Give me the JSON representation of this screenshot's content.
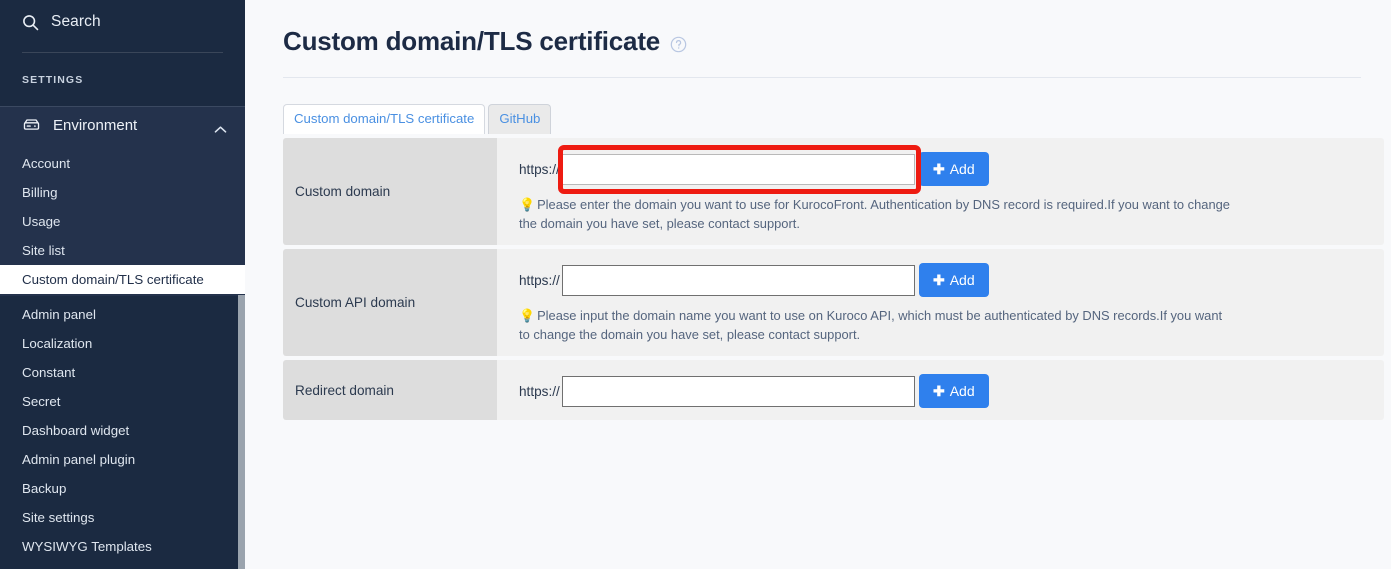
{
  "sidebar": {
    "search": {
      "label": "Search",
      "icon": "search-icon"
    },
    "section_label": "SETTINGS",
    "group": {
      "label": "Environment",
      "icon": "server-icon",
      "chevron": "chevron-up-icon",
      "expanded": true
    },
    "items": [
      {
        "label": "Account",
        "active": false
      },
      {
        "label": "Billing",
        "active": false
      },
      {
        "label": "Usage",
        "active": false
      },
      {
        "label": "Site list",
        "active": false
      },
      {
        "label": "Custom domain/TLS certificate",
        "active": true
      },
      {
        "label": "Admin panel",
        "active": false
      },
      {
        "label": "Localization",
        "active": false
      },
      {
        "label": "Constant",
        "active": false
      },
      {
        "label": "Secret",
        "active": false
      },
      {
        "label": "Dashboard widget",
        "active": false
      },
      {
        "label": "Admin panel plugin",
        "active": false
      },
      {
        "label": "Backup",
        "active": false
      },
      {
        "label": "Site settings",
        "active": false
      },
      {
        "label": "WYSIWYG Templates",
        "active": false
      }
    ]
  },
  "header": {
    "title": "Custom domain/TLS certificate",
    "help_icon": "help-circle-icon"
  },
  "tabs": [
    {
      "label": "Custom domain/TLS certificate",
      "active": true
    },
    {
      "label": "GitHub",
      "active": false
    }
  ],
  "rows": [
    {
      "label": "Custom domain",
      "protocol": "https://",
      "value": "",
      "placeholder": "",
      "button": "Add",
      "highlighted": true,
      "hint": "Please enter the domain you want to use for KurocoFront. Authentication by DNS record is required.If you want to change the domain you have set, please contact support."
    },
    {
      "label": "Custom API domain",
      "protocol": "https://",
      "value": "",
      "placeholder": "",
      "button": "Add",
      "highlighted": false,
      "hint": "Please input the domain name you want to use on Kuroco API, which must be authenticated by DNS records.If you want to change the domain you have set, please contact support."
    },
    {
      "label": "Redirect domain",
      "protocol": "https://",
      "value": "",
      "placeholder": "",
      "button": "Add",
      "highlighted": false,
      "hint": ""
    }
  ],
  "colors": {
    "sidebar_bg": "#1b2a41",
    "sidebar_group_bg": "#24324c",
    "accent_blue": "#2f80ed",
    "tab_link": "#4a90e2",
    "highlight_red": "#ee1b11",
    "row_label_bg": "#dddddd",
    "row_field_bg": "#f1f1f1",
    "page_bg": "#f8f9fb",
    "hint_bulb": "#f58220"
  }
}
